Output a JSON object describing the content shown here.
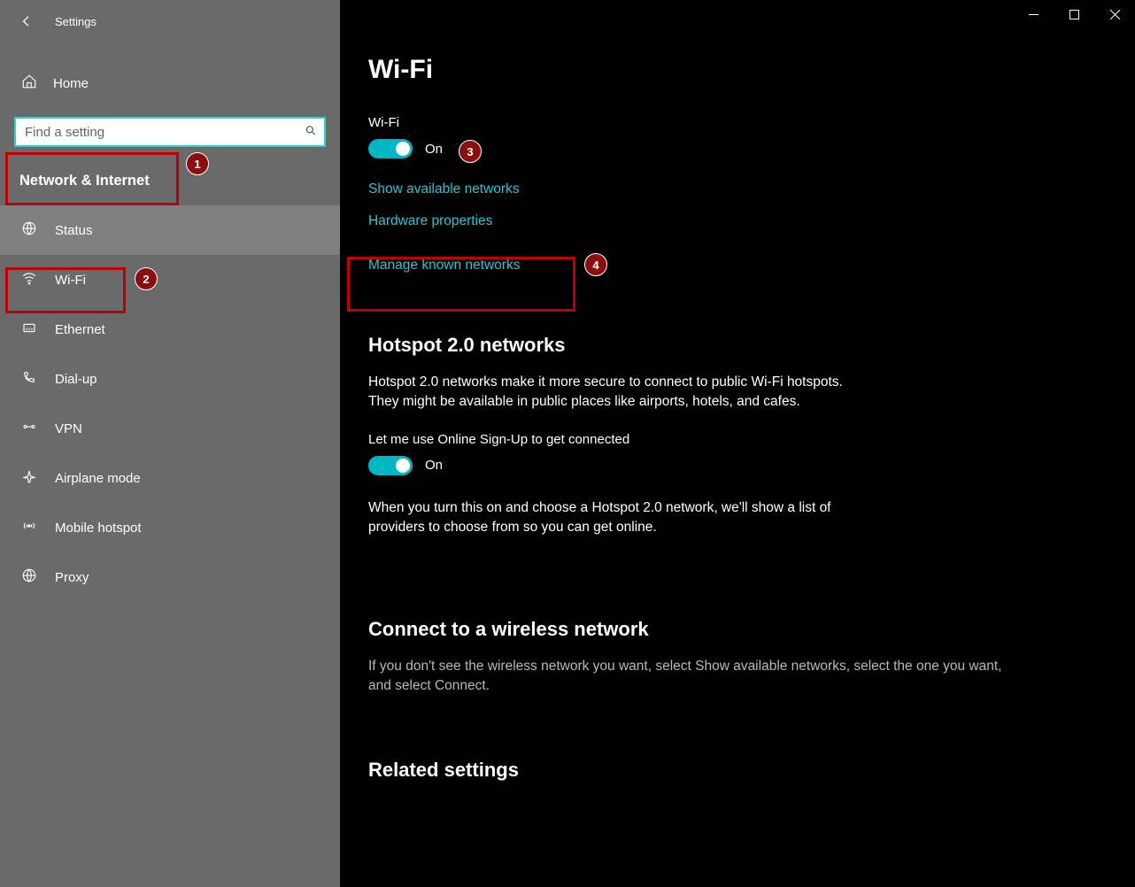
{
  "header": {
    "title": "Settings"
  },
  "sidebar": {
    "home_label": "Home",
    "search_placeholder": "Find a setting",
    "category_label": "Network & Internet",
    "items": [
      {
        "label": "Status"
      },
      {
        "label": "Wi-Fi"
      },
      {
        "label": "Ethernet"
      },
      {
        "label": "Dial-up"
      },
      {
        "label": "VPN"
      },
      {
        "label": "Airplane mode"
      },
      {
        "label": "Mobile hotspot"
      },
      {
        "label": "Proxy"
      }
    ]
  },
  "main": {
    "page_title": "Wi-Fi",
    "wifi_section_label": "Wi-Fi",
    "wifi_toggle_state": "On",
    "link_show_networks": "Show available networks",
    "link_hardware_props": "Hardware properties",
    "link_manage_networks": "Manage known networks",
    "hotspot_title": "Hotspot 2.0 networks",
    "hotspot_desc": "Hotspot 2.0 networks make it more secure to connect to public Wi-Fi hotspots. They might be available in public places like airports, hotels, and cafes.",
    "hotspot_signup_label": "Let me use Online Sign-Up to get connected",
    "hotspot_toggle_state": "On",
    "hotspot_signup_desc": "When you turn this on and choose a Hotspot 2.0 network, we'll show a list of providers to choose from so you can get online.",
    "connect_title": "Connect to a wireless network",
    "connect_desc": "If you don't see the wireless network you want, select Show available networks, select the one you want, and select Connect.",
    "related_title": "Related settings"
  },
  "annotations": {
    "badge1": "1",
    "badge2": "2",
    "badge3": "3",
    "badge4": "4"
  }
}
